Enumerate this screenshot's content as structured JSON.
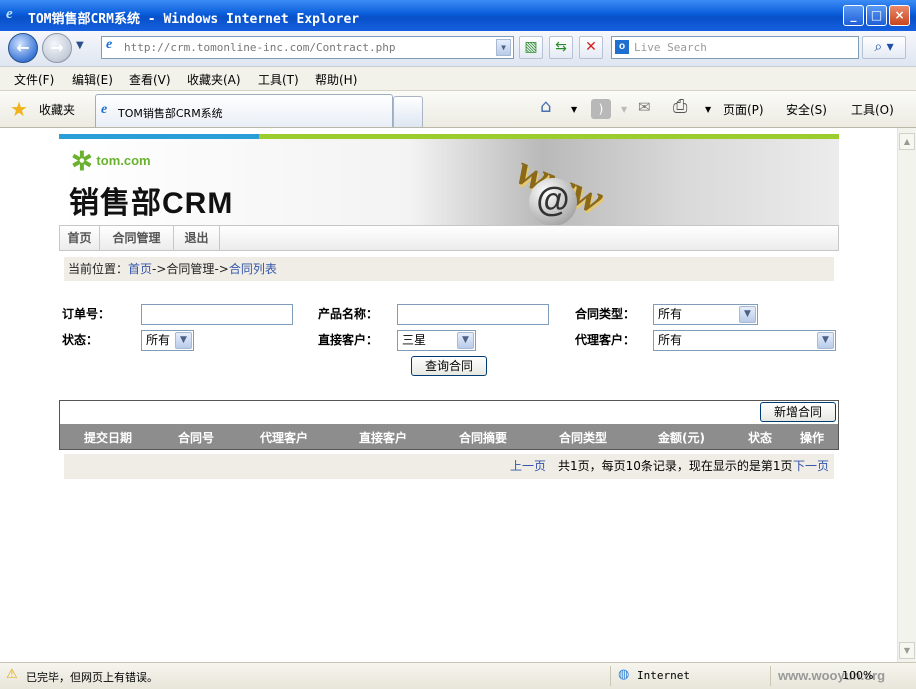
{
  "window": {
    "title": "TOM销售部CRM系统 - Windows Internet Explorer"
  },
  "address": {
    "url": "http://crm.tomonline-inc.com/Contract.php",
    "search_placeholder": "Live Search"
  },
  "menu": {
    "file": "文件(F)",
    "edit": "编辑(E)",
    "view": "查看(V)",
    "favorites": "收藏夹(A)",
    "tools": "工具(T)",
    "help": "帮助(H)"
  },
  "tabs": {
    "favorites_label": "收藏夹",
    "active_tab": "TOM销售部CRM系统"
  },
  "commandbar": {
    "page": "页面(P)",
    "safety": "安全(S)",
    "tools": "工具(O)"
  },
  "page": {
    "logo": "tom.com",
    "app_title": "销售部CRM",
    "nav": [
      "首页",
      "合同管理",
      "退出"
    ],
    "breadcrumb": {
      "prefix": "当前位置：",
      "home": "首页",
      "sep1": "->",
      "mid": "合同管理",
      "sep2": "->",
      "current": "合同列表"
    },
    "form": {
      "order_no_label": "订单号：",
      "product_label": "产品名称：",
      "contract_type_label": "合同类型：",
      "contract_type_value": "所有",
      "status_label": "状态：",
      "status_value": "所有",
      "direct_customer_label": "直接客户：",
      "direct_customer_value": "三星",
      "agent_customer_label": "代理客户：",
      "agent_customer_value": "所有",
      "query_button": "查询合同"
    },
    "table": {
      "add_button": "新增合同",
      "columns": [
        "提交日期",
        "合同号",
        "代理客户",
        "直接客户",
        "合同摘要",
        "合同类型",
        "金额(元)",
        "状态",
        "操作"
      ]
    },
    "pager": {
      "prev": "上一页",
      "info": "共1页，每页10条记录，现在显示的是第1页",
      "next": "下一页"
    }
  },
  "status": {
    "text": "已完毕，但网页上有错误。",
    "zone": "Internet",
    "zoom": "100%",
    "watermark": "www.wooyun.org"
  }
}
